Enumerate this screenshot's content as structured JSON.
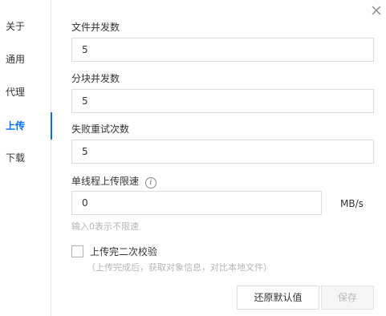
{
  "sidebar": {
    "items": [
      {
        "label": "关于"
      },
      {
        "label": "通用"
      },
      {
        "label": "代理"
      },
      {
        "label": "上传"
      },
      {
        "label": "下载"
      }
    ],
    "active_index": 3,
    "accent_color": "#006eff"
  },
  "dialog": {
    "close_icon": "close-icon"
  },
  "form": {
    "file_concurrency": {
      "label": "文件并发数",
      "value": "5"
    },
    "chunk_concurrency": {
      "label": "分块并发数",
      "value": "5"
    },
    "retry_count": {
      "label": "失败重试次数",
      "value": "5"
    },
    "speed_limit": {
      "label": "单线程上传限速",
      "value": "0",
      "unit": "MB/s",
      "hint": "输入0表示不限速",
      "info_icon": "info-icon"
    },
    "double_check": {
      "label": "上传完二次校验",
      "description": "（上传完成后，获取对象信息，对比本地文件）",
      "checked": false
    }
  },
  "actions": {
    "restore_label": "还原默认值",
    "save_label": "保存"
  }
}
